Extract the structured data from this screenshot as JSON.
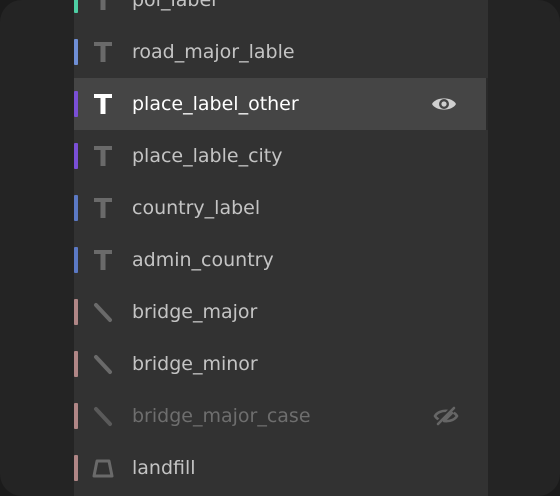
{
  "layers": [
    {
      "name": "poi_label",
      "type": "symbol",
      "stripe_color": "#4ecfa4",
      "selected": false,
      "visibility": "visible",
      "visibility_icon": ""
    },
    {
      "name": "road_major_lable",
      "type": "symbol",
      "stripe_color": "#6f8fd6",
      "selected": false,
      "visibility": "visible",
      "visibility_icon": ""
    },
    {
      "name": "place_label_other",
      "type": "symbol",
      "stripe_color": "#7a4fd6",
      "selected": true,
      "visibility": "visible",
      "visibility_icon": "eye-icon"
    },
    {
      "name": "place_lable_city",
      "type": "symbol",
      "stripe_color": "#7a4fd6",
      "selected": false,
      "visibility": "visible",
      "visibility_icon": ""
    },
    {
      "name": "country_label",
      "type": "symbol",
      "stripe_color": "#5b79c4",
      "selected": false,
      "visibility": "visible",
      "visibility_icon": ""
    },
    {
      "name": "admin_country",
      "type": "symbol",
      "stripe_color": "#5b79c4",
      "selected": false,
      "visibility": "visible",
      "visibility_icon": ""
    },
    {
      "name": "bridge_major",
      "type": "line",
      "stripe_color": "#b08686",
      "selected": false,
      "visibility": "visible",
      "visibility_icon": ""
    },
    {
      "name": "bridge_minor",
      "type": "line",
      "stripe_color": "#b08686",
      "selected": false,
      "visibility": "visible",
      "visibility_icon": ""
    },
    {
      "name": "bridge_major_case",
      "type": "line",
      "stripe_color": "#b08686",
      "selected": false,
      "visibility": "hidden",
      "visibility_icon": "eye-off-icon"
    },
    {
      "name": "landfill",
      "type": "fill",
      "stripe_color": "#b08686",
      "selected": false,
      "visibility": "visible",
      "visibility_icon": ""
    }
  ]
}
